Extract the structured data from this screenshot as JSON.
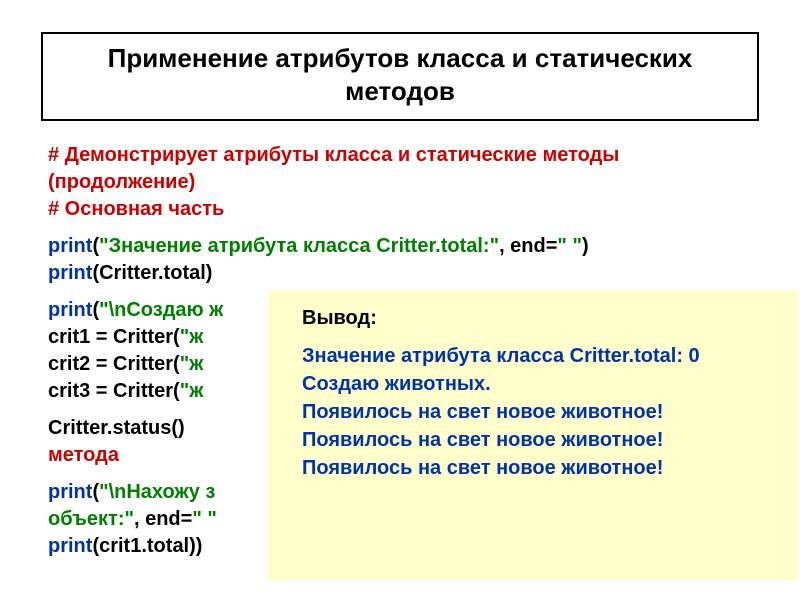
{
  "title": "Применение атрибутов класса и статических  методов",
  "code": {
    "comment1": "# Демонстрирует атрибуты класса и статические методы (продолжение)",
    "comment2": "# Основная часть",
    "print_kw": "print",
    "line1_str": "\"Значение атрибута класса Critter.total:\"",
    "line1_mid": ", end=",
    "line1_end_str": "\" \"",
    "line1_close": ")",
    "line2_rest": "(Critter.total)",
    "line3_open": "(",
    "line3_str": "\"\\nСоздаю ж",
    "crit1_a": "crit1 = Critter(",
    "crit1_b": "\"ж",
    "crit2_a": "crit2 = Critter(",
    "crit2_b": "\"ж",
    "crit3_a": "crit3 = Critter(",
    "crit3_b": "\"ж",
    "status_call": "Critter.status()",
    "metoda": "метода",
    "line8_open": "(",
    "line8_str": "\"\\nНахожу з",
    "line9_str": "объект:\"",
    "line9_mid": ", end=",
    "line9_end": "\" \"",
    "line10_rest": "(crit1.total))"
  },
  "output": {
    "heading": "Вывод:",
    "line1": "Значение атрибута класса Critter.total:  0",
    "blank": "",
    "line2": "Создаю животных.",
    "line3": "Появилось на свет новое животное!",
    "line4": "Появилось на свет новое животное!",
    "line5": "Появилось на свет новое животное!"
  }
}
